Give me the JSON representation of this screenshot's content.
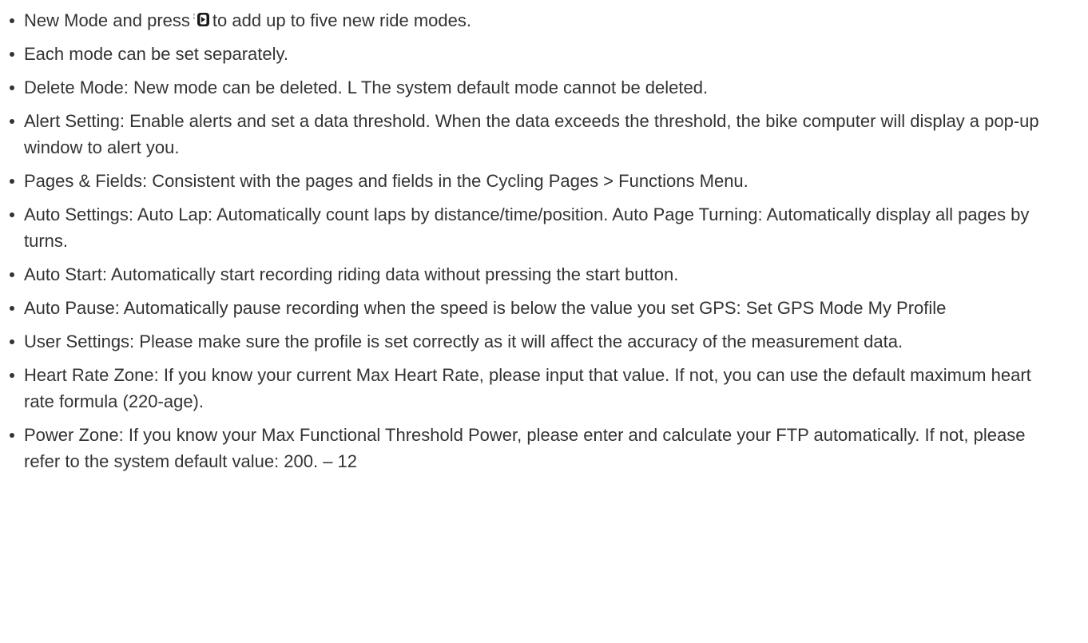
{
  "items": [
    {
      "before_icon": "New Mode and press",
      "icon": "enter-button-icon",
      "after_icon": "to add up to five new ride modes."
    },
    {
      "text": "Each mode can be set separately."
    },
    {
      "text": "Delete Mode: New mode can be deleted. L The system default mode cannot be deleted."
    },
    {
      "text": "Alert Setting: Enable alerts and set a data threshold. When the data exceeds the threshold, the bike computer will display a pop-up window to alert you."
    },
    {
      "text": "Pages & Fields: Consistent with the pages and fields in the Cycling Pages > Functions Menu."
    },
    {
      "text": "Auto Settings: Auto Lap: Automatically count laps by distance/time/position. Auto Page Turning: Automatically display all pages by turns."
    },
    {
      "text": "Auto Start: Automatically start recording riding data without pressing the start button."
    },
    {
      "text": "Auto Pause: Automatically pause recording when the speed is below the value you set GPS: Set GPS Mode My Profile"
    },
    {
      "text": "User Settings: Please make sure the profile is set correctly as it will affect the accuracy of the measurement data."
    },
    {
      "text": "Heart Rate Zone: If you know your current Max Heart Rate, please input that value. If not, you can use the default maximum heart rate formula (220-age)."
    },
    {
      "text": "Power Zone: If you know your Max Functional Threshold Power, please enter and calculate your FTP automatically. If not, please refer to the system default value: 200. – 12"
    }
  ]
}
